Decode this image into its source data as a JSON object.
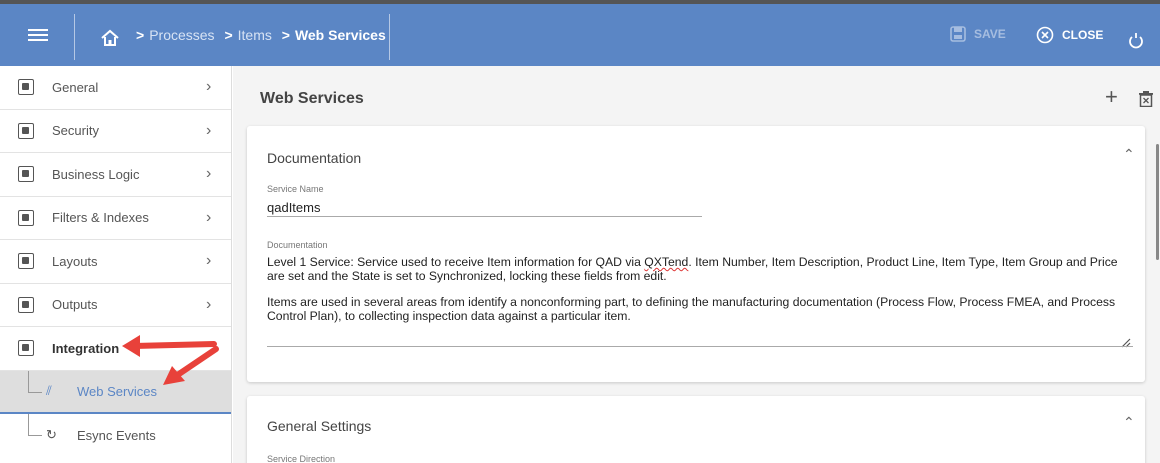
{
  "topbar": {
    "breadcrumb": [
      "Processes",
      "Items",
      "Web Services"
    ],
    "save_label": "SAVE",
    "close_label": "CLOSE"
  },
  "sidebar": {
    "items": [
      {
        "label": "General",
        "icon": "gear-folder-icon"
      },
      {
        "label": "Security",
        "icon": "lock-folder-icon"
      },
      {
        "label": "Business Logic",
        "icon": "chart-folder-icon"
      },
      {
        "label": "Filters & Indexes",
        "icon": "filter-folder-icon"
      },
      {
        "label": "Layouts",
        "icon": "layout-folder-icon"
      },
      {
        "label": "Outputs",
        "icon": "output-folder-icon"
      },
      {
        "label": "Integration",
        "icon": "integration-folder-icon"
      }
    ],
    "sub_items": [
      {
        "label": "Web Services",
        "icon": "wireless-icon"
      },
      {
        "label": "Esync Events",
        "icon": "sync-icon"
      }
    ]
  },
  "main": {
    "title": "Web Services",
    "documentation_card": {
      "title": "Documentation",
      "service_name_label": "Service Name",
      "service_name_value": "qadItems",
      "documentation_label": "Documentation",
      "doc_p1_prefix": "Level 1 Service: Service used to receive Item information for QAD via ",
      "doc_p1_link": "QXTend",
      "doc_p1_suffix": ".  Item Number, Item Description, Product Line, Item Type, Item Group and Price are set and the State is set to Synchronized, locking these fields from edit.",
      "doc_p2": "Items are used in several areas from identify a nonconforming part, to defining the manufacturing documentation (Process Flow, Process FMEA, and Process Control Plan), to collecting inspection data against a particular item."
    },
    "general_card": {
      "title": "General Settings",
      "service_direction_label": "Service Direction"
    }
  },
  "colors": {
    "header": "#5b86c5",
    "annotation_arrow": "#e8413a"
  }
}
